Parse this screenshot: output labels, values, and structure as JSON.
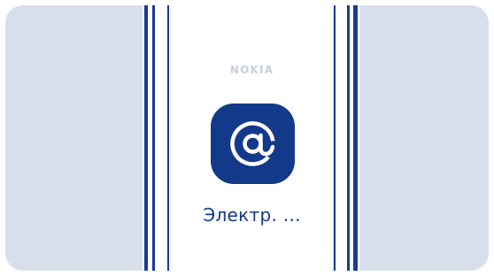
{
  "phone": {
    "brand": "NOKIA"
  },
  "home_screen": {
    "app": {
      "icon": "at-sign-icon",
      "label": "Электр. ..."
    }
  },
  "colors": {
    "background": "#d8dfec",
    "accent": "#13398a",
    "rail": "#1a3a8f",
    "brand_text": "#c8d0dc"
  }
}
